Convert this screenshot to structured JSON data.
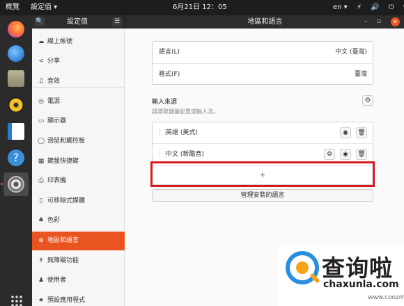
{
  "topbar": {
    "activities": "概覽",
    "app_menu": "設定值 ▾",
    "clock": "6月21日 12：05",
    "input_indicator": "en ▾",
    "status_icons": "⚡ 🔊 ⏻ ▾"
  },
  "dock": {
    "items": [
      {
        "icon": "firefox-icon",
        "label": "Firefox"
      },
      {
        "icon": "thunderbird-icon",
        "label": "Thunderbird"
      },
      {
        "icon": "files-icon",
        "label": "Files"
      },
      {
        "icon": "rhythmbox-icon",
        "label": "Rhythmbox"
      },
      {
        "icon": "writer-icon",
        "label": "Writer"
      },
      {
        "icon": "help-icon",
        "label": "?"
      },
      {
        "icon": "settings-icon",
        "label": "Settings"
      }
    ]
  },
  "header": {
    "sidebar_title": "設定值",
    "search_icon": "🔍",
    "menu_icon": "☰",
    "window_title": "地區和語言",
    "minimize": "–",
    "maximize": "▫",
    "close": "✕"
  },
  "sidebar": {
    "items": [
      {
        "icon": "☁",
        "label": "線上帳號"
      },
      {
        "icon": "<",
        "label": "分享"
      },
      {
        "icon": "♫",
        "label": "音效"
      },
      {
        "icon": "◎",
        "label": "電源"
      },
      {
        "icon": "▭",
        "label": "顯示器"
      },
      {
        "icon": "◯",
        "label": "滑鼠和觸控板"
      },
      {
        "icon": "▦",
        "label": "鍵盤快捷鍵"
      },
      {
        "icon": "⎙",
        "label": "印表機"
      },
      {
        "icon": "▯",
        "label": "可移除式媒體"
      },
      {
        "icon": "♣",
        "label": "色彩"
      },
      {
        "icon": "⊕",
        "label": "地區和語言"
      },
      {
        "icon": "✝",
        "label": "無障礙功能"
      },
      {
        "icon": "♟",
        "label": "使用者"
      },
      {
        "icon": "★",
        "label": "預設應用程式"
      }
    ],
    "active_index": 10
  },
  "region": {
    "language_label": "語言(L)",
    "language_value": "中文 (臺灣)",
    "formats_label": "格式(F)",
    "formats_value": "臺灣"
  },
  "input_sources": {
    "title": "輸入來源",
    "subtitle": "請選取鍵盤配置或輸入法。",
    "gear": "⚙",
    "sources": [
      {
        "drag": "⋮⋮",
        "name": "英語 (美式)"
      },
      {
        "drag": "⋮⋮",
        "name": "中文 (新酷音)"
      }
    ],
    "eye": "◉",
    "trash": "🗑",
    "add": "+"
  },
  "manage_languages": "管理安裝的語言",
  "watermark": {
    "brand": "查询啦",
    "url": "chaxunla.com",
    "url2": "www.coozm.com"
  },
  "colors": {
    "accent": "#e95420",
    "highlight": "#d7191f",
    "topbar": "#1d1d1d",
    "dock": "#2b2b2b"
  }
}
